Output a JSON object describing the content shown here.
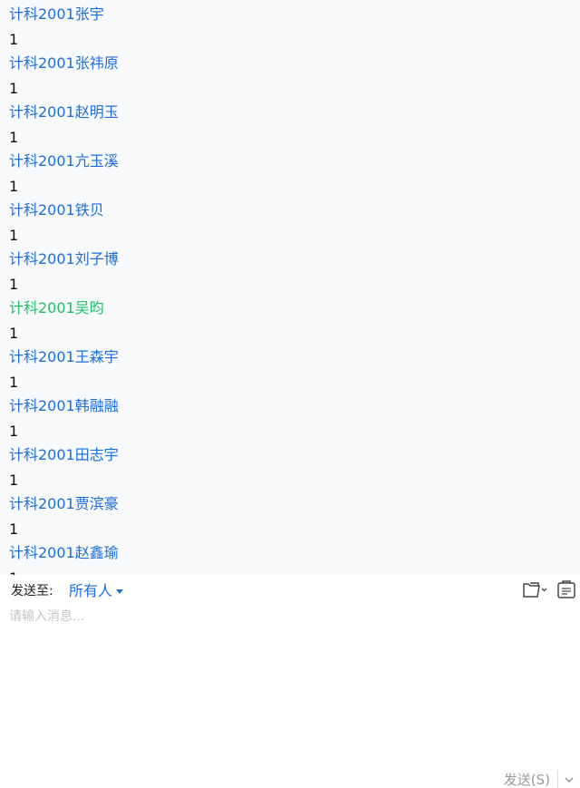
{
  "messages": [
    {
      "sender": "计科2001张宇",
      "content": "1",
      "self": false
    },
    {
      "sender": "计科2001张祎原",
      "content": "1",
      "self": false
    },
    {
      "sender": "计科2001赵明玉",
      "content": "1",
      "self": false
    },
    {
      "sender": "计科2001亢玉溪",
      "content": "1",
      "self": false
    },
    {
      "sender": "计科2001铁贝",
      "content": "1",
      "self": false
    },
    {
      "sender": "计科2001刘子博",
      "content": "1",
      "self": false
    },
    {
      "sender": "计科2001吴昀",
      "content": "1",
      "self": true
    },
    {
      "sender": "计科2001王森宇",
      "content": "1",
      "self": false
    },
    {
      "sender": "计科2001韩融融",
      "content": "1",
      "self": false
    },
    {
      "sender": "计科2001田志宇",
      "content": "1",
      "self": false
    },
    {
      "sender": "计科2001贾滨豪",
      "content": "1",
      "self": false
    },
    {
      "sender": "计科2001赵鑫瑜",
      "content": "1",
      "self": false
    }
  ],
  "composer": {
    "send_to_label": "发送至:",
    "recipient": "所有人",
    "placeholder": "请输入消息...",
    "send_label": "发送(S)",
    "icons": {
      "file": "folder-icon",
      "notice": "announcement-icon"
    }
  },
  "colors": {
    "sender": "#1d6ddb",
    "self_sender": "#1fbf6a",
    "log_background": "#f8f9fb"
  }
}
